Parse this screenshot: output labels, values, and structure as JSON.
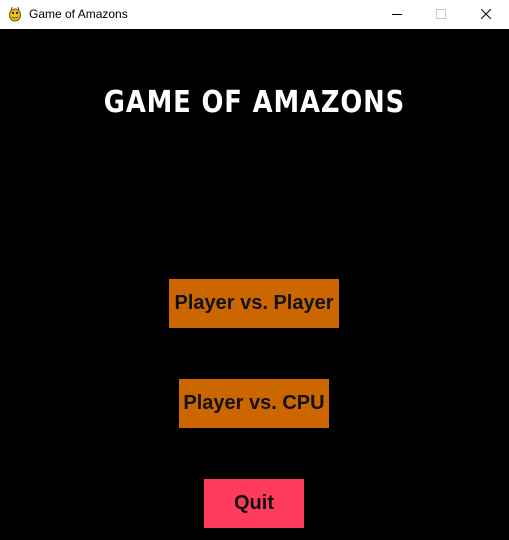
{
  "window": {
    "title": "Game of Amazons",
    "icon": "pygame-snake-icon",
    "controls": {
      "minimize_icon": "minimize-icon",
      "maximize_icon": "maximize-icon",
      "close_icon": "close-icon"
    }
  },
  "main_menu": {
    "title": "GAME OF AMAZONS",
    "buttons": {
      "player_vs_player": "Player vs. Player",
      "player_vs_cpu": "Player vs. CPU",
      "quit": "Quit"
    }
  },
  "colors": {
    "background": "#000000",
    "title_text": "#ffffff",
    "mode_button": "#cc6600",
    "quit_button": "#ff3b5c",
    "button_text": "#111111"
  }
}
